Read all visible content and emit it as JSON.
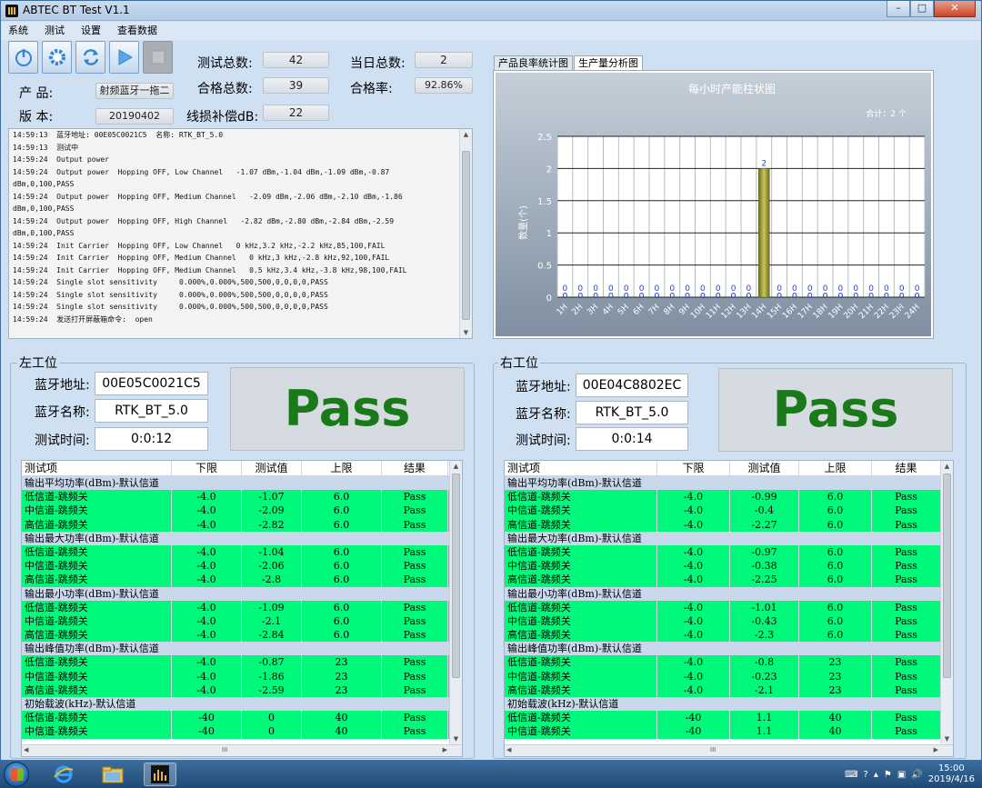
{
  "window": {
    "title": "ABTEC BT Test  V1.1",
    "min": "–",
    "max": "□",
    "close": "✕"
  },
  "menu": [
    "系统",
    "测试",
    "设置",
    "查看数据"
  ],
  "toolbar": [
    {
      "icon": "power-icon"
    },
    {
      "icon": "settings-gear-icon"
    },
    {
      "icon": "refresh-icon"
    },
    {
      "icon": "play-icon"
    },
    {
      "icon": "stop-icon"
    }
  ],
  "info": {
    "product_label": "产    品:",
    "product_value": "射频蓝牙一拖二",
    "version_label": "版    本:",
    "version_value": "20190402",
    "test_total_label": "测试总数:",
    "test_total_value": "42",
    "pass_total_label": "合格总数:",
    "pass_total_value": "39",
    "loss_label": "线损补偿dB:",
    "loss_value": "22",
    "day_total_label": "当日总数:",
    "day_total_value": "2",
    "pass_rate_label": "合格率:",
    "pass_rate_value": "92.86%"
  },
  "log": [
    "14:59:13  蓝牙地址: 00E05C0021C5  名称: RTK_BT_5.0",
    "14:59:13  测试中",
    "14:59:24  Output power",
    "14:59:24  Output power  Hopping OFF, Low Channel   -1.07 dBm,-1.04 dBm,-1.09 dBm,-0.87",
    "dBm,0,100,PASS",
    "14:59:24  Output power  Hopping OFF, Medium Channel   -2.09 dBm,-2.06 dBm,-2.10 dBm,-1.86",
    "dBm,0,100,PASS",
    "14:59:24  Output power  Hopping OFF, High Channel   -2.82 dBm,-2.80 dBm,-2.84 dBm,-2.59",
    "dBm,0,100,PASS",
    "14:59:24  Init Carrier  Hopping OFF, Low Channel   0 kHz,3.2 kHz,-2.2 kHz,85,100,FAIL",
    "14:59:24  Init Carrier  Hopping OFF, Medium Channel   0 kHz,3 kHz,-2.8 kHz,92,100,FAIL",
    "14:59:24  Init Carrier  Hopping OFF, Medium Channel   0.5 kHz,3.4 kHz,-3.8 kHz,98,100,FAIL",
    "14:59:24  Single slot sensitivity     0.000%,0.000%,500,500,0,0,0,0,PASS",
    "14:59:24  Single slot sensitivity     0.000%,0.000%,500,500,0,0,0,0,PASS",
    "14:59:24  Single slot sensitivity     0.000%,0.000%,500,500,0,0,0,0,PASS",
    "14:59:24  发送打开屏蔽箱命令:  open"
  ],
  "tabs": [
    "产品良率统计图",
    "生产量分析图"
  ],
  "chart_data": {
    "type": "bar",
    "title": "每小时产能柱状图",
    "subtitle": "合计：2 个",
    "ylabel": "数量(个)",
    "categories": [
      "1H",
      "2H",
      "3H",
      "4H",
      "5H",
      "6H",
      "7H",
      "8H",
      "9H",
      "10H",
      "11H",
      "12H",
      "13H",
      "14H",
      "15H",
      "16H",
      "17H",
      "18H",
      "19H",
      "20H",
      "21H",
      "22H",
      "23H",
      "24H"
    ],
    "values": [
      0,
      0,
      0,
      0,
      0,
      0,
      0,
      0,
      0,
      0,
      0,
      0,
      0,
      2,
      0,
      0,
      0,
      0,
      0,
      0,
      0,
      0,
      0,
      0
    ],
    "ylim": [
      0,
      2.5
    ],
    "yticks": [
      "0",
      "0.5",
      "1",
      "1.5",
      "2",
      "2.5"
    ],
    "colors": {
      "bar": "#9c9c3c",
      "label": "#2a3fd0"
    }
  },
  "left": {
    "group_label": "左工位",
    "addr_label": "蓝牙地址:",
    "addr_value": "00E05C0021C5",
    "name_label": "蓝牙名称:",
    "name_value": "RTK_BT_5.0",
    "time_label": "测试时间:",
    "time_value": "0:0:12",
    "result": "Pass"
  },
  "right": {
    "group_label": "右工位",
    "addr_label": "蓝牙地址:",
    "addr_value": "00E04C8802EC",
    "name_label": "蓝牙名称:",
    "name_value": "RTK_BT_5.0",
    "time_label": "测试时间:",
    "time_value": "0:0:14",
    "result": "Pass"
  },
  "grid_headers": [
    "测试项",
    "下限",
    "测试值",
    "上限",
    "结果"
  ],
  "left_rows": [
    {
      "t": "sec",
      "c": [
        "输出平均功率(dBm)-默认信道",
        "",
        "",
        "",
        ""
      ]
    },
    {
      "t": "itm",
      "c": [
        "低信道-跳频关",
        "-4.0",
        "-1.07",
        "6.0",
        "Pass"
      ]
    },
    {
      "t": "itm",
      "c": [
        "中信道-跳频关",
        "-4.0",
        "-2.09",
        "6.0",
        "Pass"
      ]
    },
    {
      "t": "itm",
      "c": [
        "高信道-跳频关",
        "-4.0",
        "-2.82",
        "6.0",
        "Pass"
      ]
    },
    {
      "t": "sec",
      "c": [
        "输出最大功率(dBm)-默认信道",
        "",
        "",
        "",
        ""
      ]
    },
    {
      "t": "itm",
      "c": [
        "低信道-跳频关",
        "-4.0",
        "-1.04",
        "6.0",
        "Pass"
      ]
    },
    {
      "t": "itm",
      "c": [
        "中信道-跳频关",
        "-4.0",
        "-2.06",
        "6.0",
        "Pass"
      ]
    },
    {
      "t": "itm",
      "c": [
        "高信道-跳频关",
        "-4.0",
        "-2.8",
        "6.0",
        "Pass"
      ]
    },
    {
      "t": "sec",
      "c": [
        "输出最小功率(dBm)-默认信道",
        "",
        "",
        "",
        ""
      ]
    },
    {
      "t": "itm",
      "c": [
        "低信道-跳频关",
        "-4.0",
        "-1.09",
        "6.0",
        "Pass"
      ]
    },
    {
      "t": "itm",
      "c": [
        "中信道-跳频关",
        "-4.0",
        "-2.1",
        "6.0",
        "Pass"
      ]
    },
    {
      "t": "itm",
      "c": [
        "高信道-跳频关",
        "-4.0",
        "-2.84",
        "6.0",
        "Pass"
      ]
    },
    {
      "t": "sec",
      "c": [
        "输出峰值功率(dBm)-默认信道",
        "",
        "",
        "",
        ""
      ]
    },
    {
      "t": "itm",
      "c": [
        "低信道-跳频关",
        "-4.0",
        "-0.87",
        "23",
        "Pass"
      ]
    },
    {
      "t": "itm",
      "c": [
        "中信道-跳频关",
        "-4.0",
        "-1.86",
        "23",
        "Pass"
      ]
    },
    {
      "t": "itm",
      "c": [
        "高信道-跳频关",
        "-4.0",
        "-2.59",
        "23",
        "Pass"
      ]
    },
    {
      "t": "sec",
      "c": [
        "初始载波(kHz)-默认信道",
        "",
        "",
        "",
        ""
      ]
    },
    {
      "t": "itm",
      "c": [
        "低信道-跳频关",
        "-40",
        "0",
        "40",
        "Pass"
      ]
    },
    {
      "t": "itm",
      "c": [
        "中信道-跳频关",
        "-40",
        "0",
        "40",
        "Pass"
      ]
    }
  ],
  "right_rows": [
    {
      "t": "sec",
      "c": [
        "输出平均功率(dBm)-默认信道",
        "",
        "",
        "",
        ""
      ]
    },
    {
      "t": "itm",
      "c": [
        "低信道-跳频关",
        "-4.0",
        "-0.99",
        "6.0",
        "Pass"
      ]
    },
    {
      "t": "itm",
      "c": [
        "中信道-跳频关",
        "-4.0",
        "-0.4",
        "6.0",
        "Pass"
      ]
    },
    {
      "t": "itm",
      "c": [
        "高信道-跳频关",
        "-4.0",
        "-2.27",
        "6.0",
        "Pass"
      ]
    },
    {
      "t": "sec",
      "c": [
        "输出最大功率(dBm)-默认信道",
        "",
        "",
        "",
        ""
      ]
    },
    {
      "t": "itm",
      "c": [
        "低信道-跳频关",
        "-4.0",
        "-0.97",
        "6.0",
        "Pass"
      ]
    },
    {
      "t": "itm",
      "c": [
        "中信道-跳频关",
        "-4.0",
        "-0.38",
        "6.0",
        "Pass"
      ]
    },
    {
      "t": "itm",
      "c": [
        "高信道-跳频关",
        "-4.0",
        "-2.25",
        "6.0",
        "Pass"
      ]
    },
    {
      "t": "sec",
      "c": [
        "输出最小功率(dBm)-默认信道",
        "",
        "",
        "",
        ""
      ]
    },
    {
      "t": "itm",
      "c": [
        "低信道-跳频关",
        "-4.0",
        "-1.01",
        "6.0",
        "Pass"
      ]
    },
    {
      "t": "itm",
      "c": [
        "中信道-跳频关",
        "-4.0",
        "-0.43",
        "6.0",
        "Pass"
      ]
    },
    {
      "t": "itm",
      "c": [
        "高信道-跳频关",
        "-4.0",
        "-2.3",
        "6.0",
        "Pass"
      ]
    },
    {
      "t": "sec",
      "c": [
        "输出峰值功率(dBm)-默认信道",
        "",
        "",
        "",
        ""
      ]
    },
    {
      "t": "itm",
      "c": [
        "低信道-跳频关",
        "-4.0",
        "-0.8",
        "23",
        "Pass"
      ]
    },
    {
      "t": "itm",
      "c": [
        "中信道-跳频关",
        "-4.0",
        "-0.23",
        "23",
        "Pass"
      ]
    },
    {
      "t": "itm",
      "c": [
        "高信道-跳频关",
        "-4.0",
        "-2.1",
        "23",
        "Pass"
      ]
    },
    {
      "t": "sec",
      "c": [
        "初始载波(kHz)-默认信道",
        "",
        "",
        "",
        ""
      ]
    },
    {
      "t": "itm",
      "c": [
        "低信道-跳频关",
        "-40",
        "1.1",
        "40",
        "Pass"
      ]
    },
    {
      "t": "itm",
      "c": [
        "中信道-跳频关",
        "-40",
        "1.1",
        "40",
        "Pass"
      ]
    }
  ],
  "scroll_mark": "III",
  "taskbar": {
    "time": "15:00",
    "date": "2019/4/16"
  }
}
